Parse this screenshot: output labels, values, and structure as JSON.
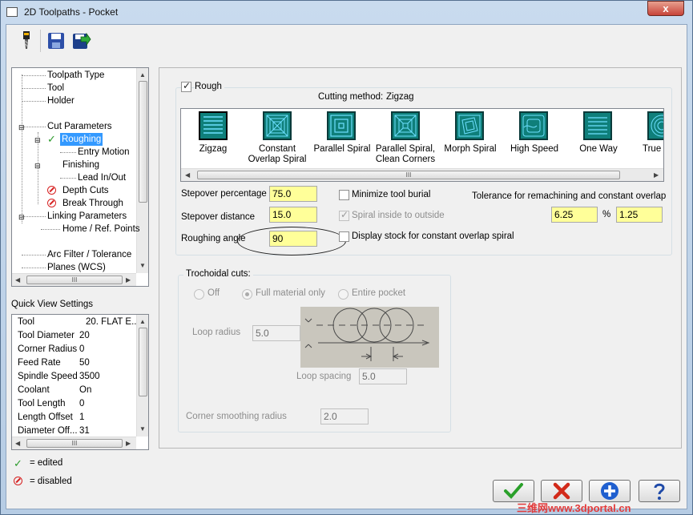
{
  "window": {
    "title": "2D Toolpaths - Pocket",
    "close_label": "x"
  },
  "tree": {
    "items": [
      "Toolpath Type",
      "Tool",
      "Holder",
      "Cut Parameters",
      "Roughing",
      "Entry Motion",
      "Finishing",
      "Lead In/Out",
      "Depth Cuts",
      "Break Through",
      "Linking Parameters",
      "Home / Ref. Points",
      "Arc Filter / Tolerance",
      "Planes (WCS)"
    ],
    "selected": "Roughing",
    "hscroll_label": "III"
  },
  "quick_view": {
    "title": "Quick View Settings",
    "rows": [
      {
        "key": "Tool",
        "value": "20. FLAT E..."
      },
      {
        "key": "Tool Diameter",
        "value": "20"
      },
      {
        "key": "Corner Radius",
        "value": "0"
      },
      {
        "key": "Feed Rate",
        "value": "50"
      },
      {
        "key": "Spindle Speed",
        "value": "3500"
      },
      {
        "key": "Coolant",
        "value": "On"
      },
      {
        "key": "Tool Length",
        "value": "0"
      },
      {
        "key": "Length Offset",
        "value": "1"
      },
      {
        "key": "Diameter Off...",
        "value": "31"
      }
    ],
    "hscroll_label": "III"
  },
  "legend": {
    "edited": "= edited",
    "disabled": "= disabled"
  },
  "rough": {
    "checkbox_label": "Rough",
    "checked": true,
    "cutting_method_label": "Cutting method:",
    "cutting_method_value": "Zigzag",
    "methods": [
      {
        "line1": "Zigzag",
        "line2": ""
      },
      {
        "line1": "Constant",
        "line2": "Overlap Spiral"
      },
      {
        "line1": "Parallel Spiral",
        "line2": ""
      },
      {
        "line1": "Parallel Spiral,",
        "line2": "Clean Corners"
      },
      {
        "line1": "Morph Spiral",
        "line2": ""
      },
      {
        "line1": "High Speed",
        "line2": ""
      },
      {
        "line1": "One Way",
        "line2": ""
      },
      {
        "line1": "True S",
        "line2": ""
      }
    ],
    "methods_scroll_label": "III"
  },
  "params": {
    "stepover_percentage_label": "Stepover percentage",
    "stepover_percentage_value": "75.0",
    "stepover_distance_label": "Stepover distance",
    "stepover_distance_value": "15.0",
    "roughing_angle_label": "Roughing angle",
    "roughing_angle_value": "90",
    "minimize_tool_burial_label": "Minimize tool burial",
    "spiral_inside_label": "Spiral inside to outside",
    "display_stock_label": "Display stock for constant overlap spiral",
    "tolerance_label": "Tolerance for remachining and constant overlap",
    "tolerance_percent_value": "6.25",
    "percent_sign": "%",
    "tolerance_value": "1.25"
  },
  "trochoidal": {
    "title": "Trochoidal cuts:",
    "options": [
      "Off",
      "Full material only",
      "Entire pocket"
    ],
    "loop_radius_label": "Loop radius",
    "loop_radius_value": "5.0",
    "loop_spacing_label": "Loop spacing",
    "loop_spacing_value": "5.0",
    "corner_smoothing_label": "Corner smoothing radius",
    "corner_smoothing_value": "2.0"
  },
  "watermark": "三维网www.3dportal.cn",
  "colors": {
    "input_highlight": "#ffff99",
    "selection": "#3399ff",
    "edited_check": "#2a9a2a",
    "disabled_mark": "#d62020",
    "ok_green": "#2aa02a",
    "cancel_red": "#d22a1a",
    "help_blue": "#1f5fcf"
  }
}
